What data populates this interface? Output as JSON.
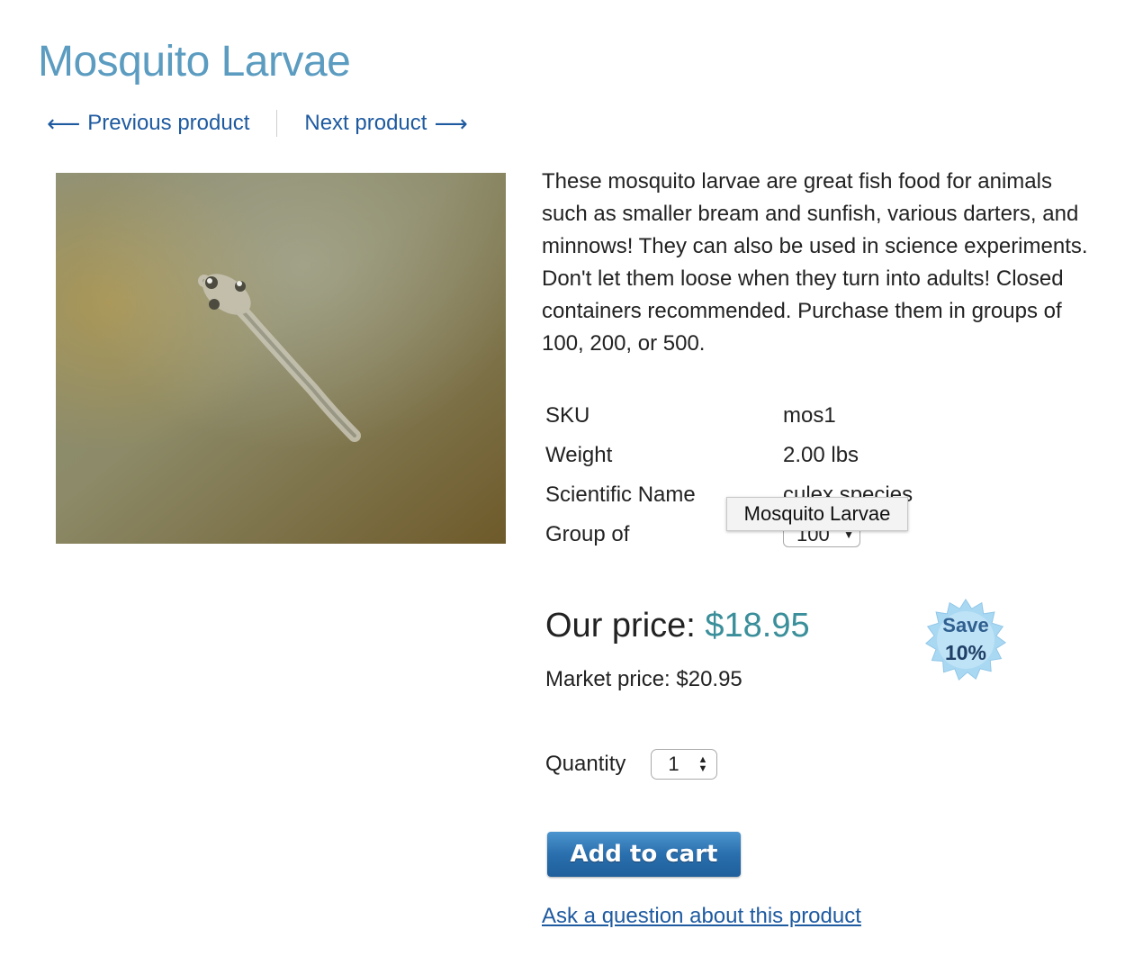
{
  "product": {
    "title": "Mosquito Larvae",
    "description": "These mosquito larvae are great fish food for animals such as smaller bream and sunfish, various darters, and minnows! They can also be used in science experiments. Don't let them loose when they turn into adults! Closed containers recommended. Purchase them in groups of 100, 200, or 500."
  },
  "nav": {
    "prev_label": "Previous product",
    "next_label": "Next product",
    "prev_arrow": "⟵",
    "next_arrow": "⟶"
  },
  "specs": [
    {
      "label": "SKU",
      "value": "mos1"
    },
    {
      "label": "Weight",
      "value": "2.00 lbs"
    },
    {
      "label": "Scientific Name",
      "value": "culex species"
    },
    {
      "label": "Group of",
      "value": "100"
    }
  ],
  "tooltip": "Mosquito Larvae",
  "price": {
    "our_label": "Our price:",
    "our_value": "$18.95",
    "market_label": "Market price:",
    "market_value": "$20.95",
    "badge_save": "Save",
    "badge_percent": "10%"
  },
  "quantity": {
    "label": "Quantity",
    "value": "1"
  },
  "add_to_cart_label": "Add to cart",
  "ask_link": "Ask a question about this product",
  "icons": {
    "prev": "arrow-left-icon",
    "next": "arrow-right-icon",
    "select": "caret-down-icon",
    "spinner": "spinner-arrows-icon",
    "badge": "starburst-badge-icon"
  },
  "colors": {
    "title": "#5b9cc0",
    "link": "#1e5aa0",
    "price": "#3a8f9a",
    "button": "#2a6fae"
  }
}
